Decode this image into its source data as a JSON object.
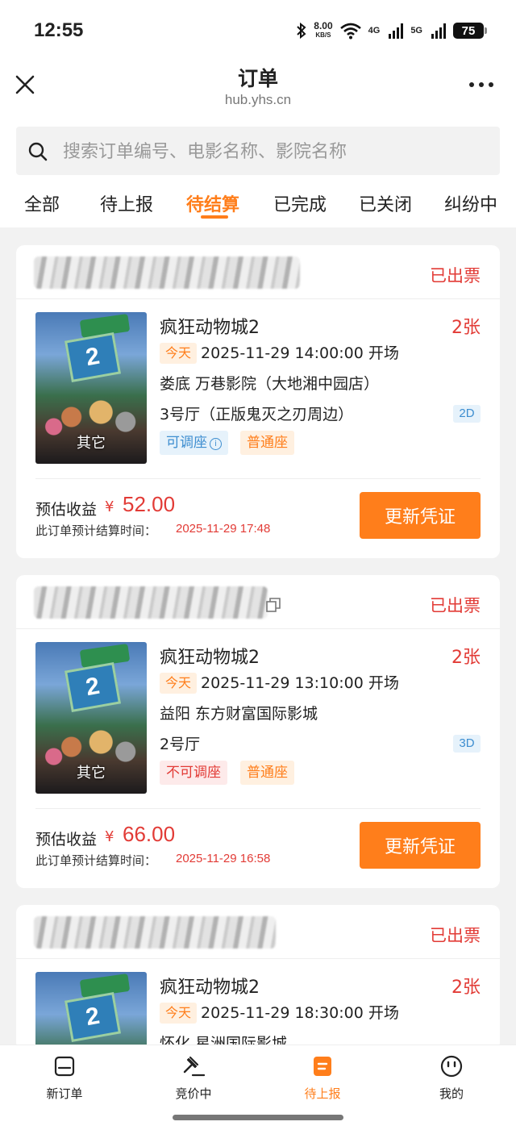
{
  "status_bar": {
    "time": "12:55",
    "net_speed": "8.00",
    "net_unit": "KB/S",
    "sig1": "4G",
    "sig2": "5G",
    "battery": "75"
  },
  "header": {
    "title": "订单",
    "subtitle": "hub.yhs.cn"
  },
  "search": {
    "placeholder": "搜索订单编号、电影名称、影院名称"
  },
  "tabs": [
    {
      "label": "全部"
    },
    {
      "label": "待上报"
    },
    {
      "label": "待结算",
      "active": true
    },
    {
      "label": "已完成"
    },
    {
      "label": "已关闭"
    },
    {
      "label": "纠纷中"
    }
  ],
  "orders": [
    {
      "status": "已出票",
      "poster_tag": "其它",
      "movie": "疯狂动物城2",
      "qty": "2张",
      "today": "今天",
      "showtime": "2025-11-29 14:00:00 开场",
      "cinema": "娄底 万巷影院（大地湘中园店）",
      "hall": "3号厅（正版鬼灭之刃周边）",
      "format": "2D",
      "adjust_tag": "可调座",
      "seat_tag": "普通座",
      "earn_label": "预估收益",
      "currency": "¥",
      "earn": "52.00",
      "settle_label": "此订单预计结算时间：",
      "settle_time": "2025-11-29 17:48",
      "button": "更新凭证"
    },
    {
      "status": "已出票",
      "poster_tag": "其它",
      "movie": "疯狂动物城2",
      "qty": "2张",
      "today": "今天",
      "showtime": "2025-11-29 13:10:00 开场",
      "cinema": "益阳 东方财富国际影城",
      "hall": "2号厅",
      "format": "3D",
      "adjust_tag": "不可调座",
      "seat_tag": "普通座",
      "earn_label": "预估收益",
      "currency": "¥",
      "earn": "66.00",
      "settle_label": "此订单预计结算时间：",
      "settle_time": "2025-11-29 16:58",
      "button": "更新凭证"
    },
    {
      "status": "已出票",
      "movie": "疯狂动物城2",
      "qty": "2张",
      "today": "今天",
      "showtime": "2025-11-29 18:30:00 开场",
      "cinema": "怀化 星洲国际影城"
    }
  ],
  "bottom_nav": [
    {
      "label": "新订单",
      "icon": "inbox-icon"
    },
    {
      "label": "竞价中",
      "icon": "gavel-icon"
    },
    {
      "label": "待上报",
      "icon": "report-icon",
      "active": true
    },
    {
      "label": "我的",
      "icon": "smiley-icon"
    }
  ],
  "colors": {
    "accent": "#ff7e1b",
    "danger": "#e23b36",
    "info": "#3e8ed0"
  }
}
